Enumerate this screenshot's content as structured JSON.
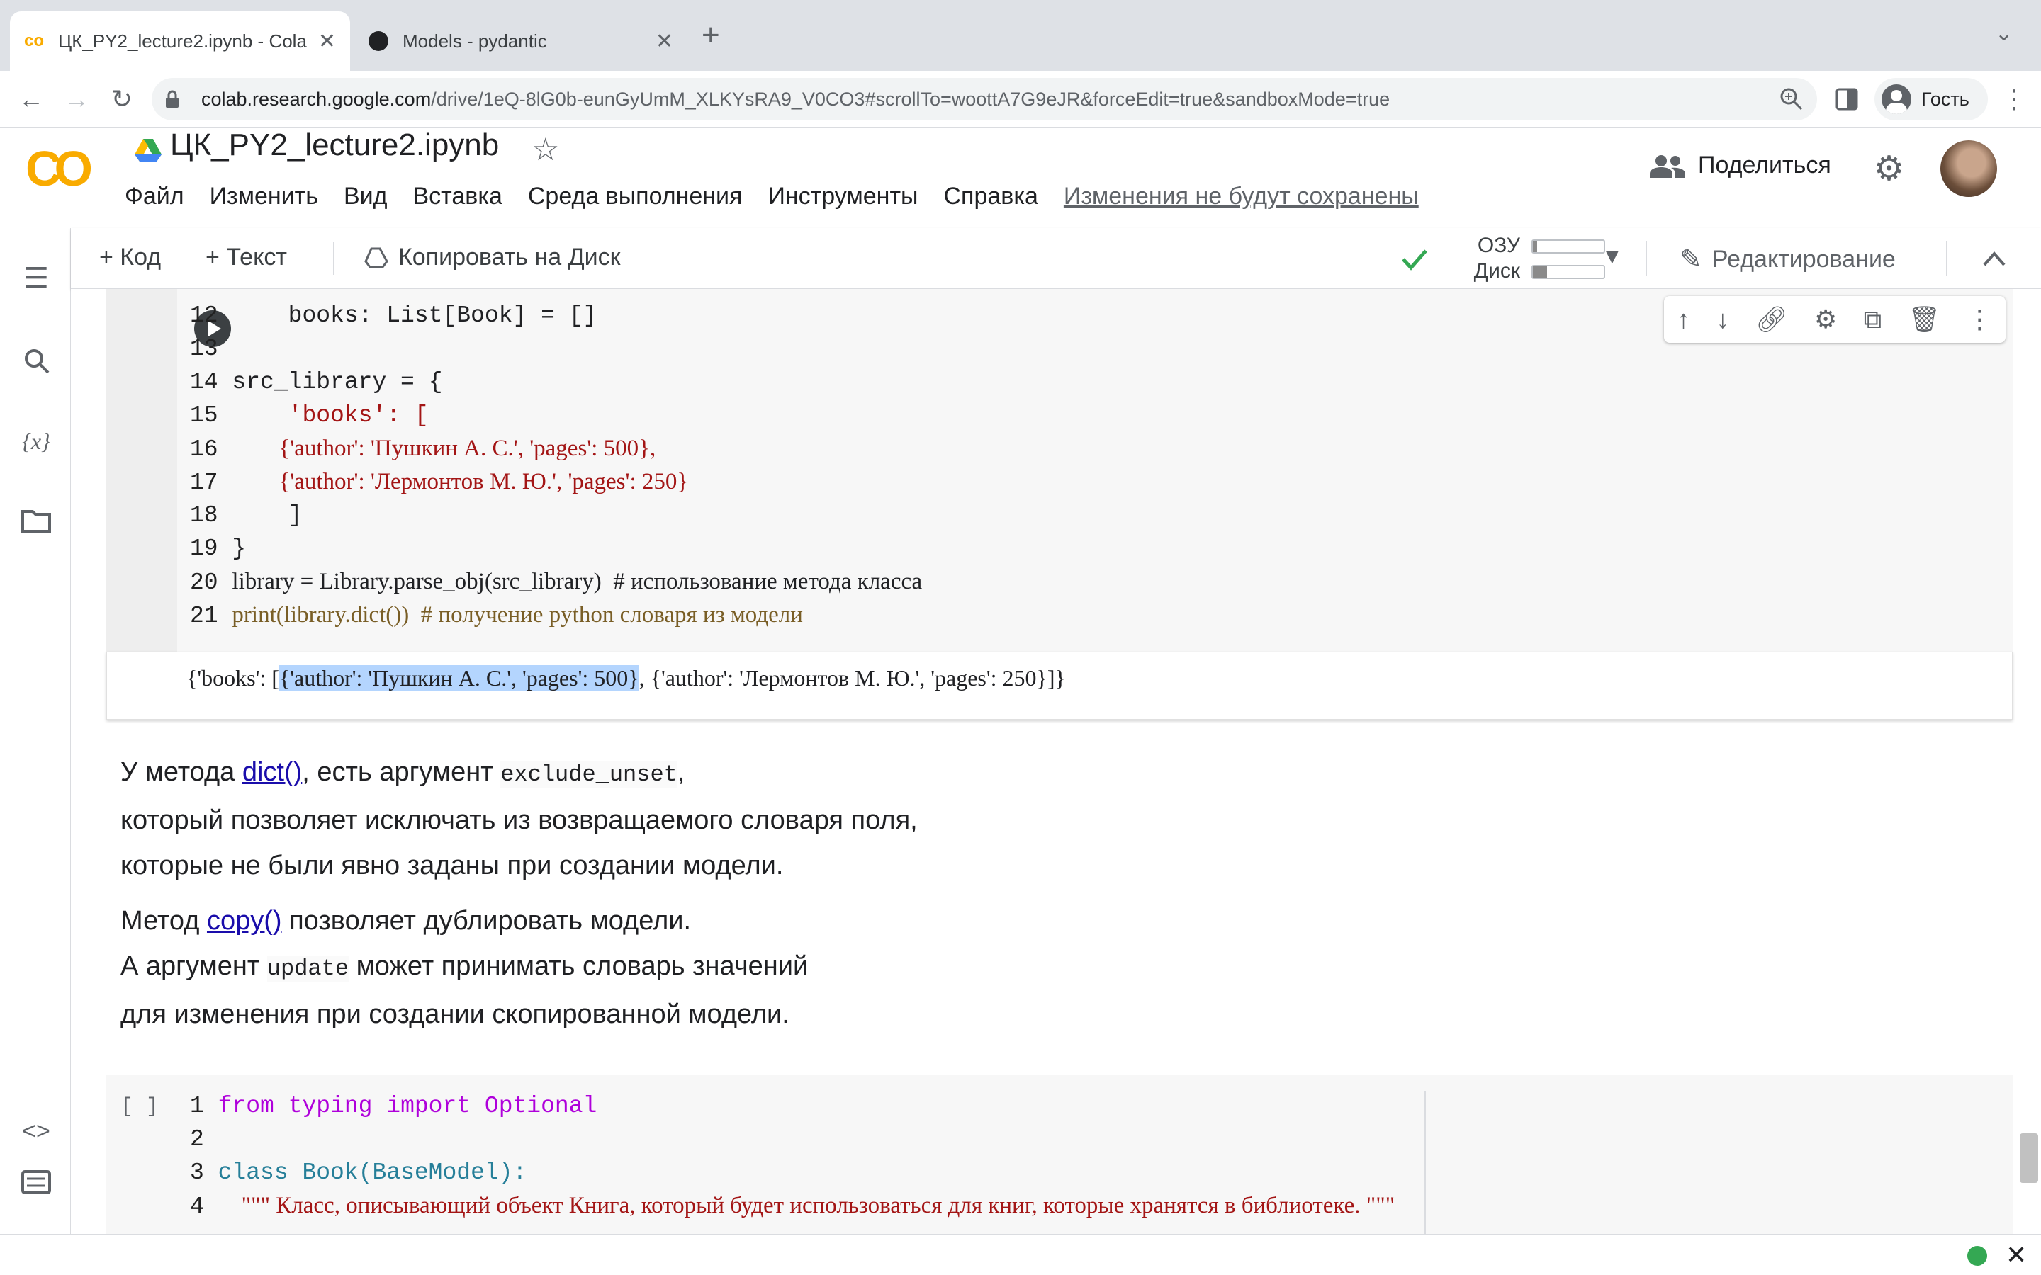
{
  "browser": {
    "tabs": [
      {
        "title": "ЦК_PY2_lecture2.ipynb - Cola",
        "favicon": "colab-favicon-icon",
        "active": true
      },
      {
        "title": "Models - pydantic",
        "favicon": "pydantic-favicon-icon",
        "active": false
      }
    ],
    "url_host": "colab.research.google.com",
    "url_path": "/drive/1eQ-8lG0b-eunGyUmM_XLKYsRA9_V0CO3#scrollTo=woottA7G9eJR&forceEdit=true&sandboxMode=true",
    "profile_label": "Гость"
  },
  "colab": {
    "logo": "CO",
    "notebook_title": "ЦК_PY2_lecture2.ipynb",
    "menu": [
      "Файл",
      "Изменить",
      "Вид",
      "Вставка",
      "Среда выполнения",
      "Инструменты",
      "Справка"
    ],
    "unsaved_notice": "Изменения не будут сохранены",
    "share_label": "Поделиться",
    "toolbar": {
      "add_code": "+ Код",
      "add_text": "+ Текст",
      "copy_to_drive": "Копировать на Диск",
      "ram_label": "ОЗУ",
      "disk_label": "Диск",
      "ram_usage": 0.06,
      "disk_usage": 0.2,
      "editing_label": "Редактирование"
    }
  },
  "cell1": {
    "lines": [
      {
        "n": "12",
        "text": "    books: List[Book] = []"
      },
      {
        "n": "13",
        "text": ""
      },
      {
        "n": "14",
        "text": "src_library = {"
      },
      {
        "n": "15",
        "text": "    'books': ["
      },
      {
        "n": "16",
        "text": "        {'author': 'Пушкин А. С.', 'pages': 500},"
      },
      {
        "n": "17",
        "text": "        {'author': 'Лермонтов М. Ю.', 'pages': 250}"
      },
      {
        "n": "18",
        "text": "    ]"
      },
      {
        "n": "19",
        "text": "}"
      },
      {
        "n": "20",
        "text": "library = Library.parse_obj(src_library)  # использование метода класса"
      },
      {
        "n": "21",
        "text": "print(library.dict())  # получение python словаря из модели"
      }
    ],
    "output_pre": "{'books': [",
    "output_selected": "{'author': 'Пушкин А. С.', 'pages': 500}",
    "output_post": ", {'author': 'Лермонтов М. Ю.', 'pages': 250}]}"
  },
  "text1": {
    "l1_a": "У метода ",
    "l1_link": "dict()",
    "l1_b": ", есть аргумент ",
    "l1_code": "exclude_unset",
    "l1_c": ",",
    "l2": "который позволяет исключать из возвращаемого словаря поля,",
    "l3": "которые не были явно заданы при создании модели."
  },
  "text2": {
    "l1_a": "Метод ",
    "l1_link": "copy()",
    "l1_b": " позволяет дублировать модели.",
    "l2_a": "А аргумент ",
    "l2_code": "update",
    "l2_b": " может принимать словарь значений",
    "l3": "для изменения при создании скопированной модели."
  },
  "cell2": {
    "exec_label": "[ ]",
    "lines": [
      {
        "n": "1",
        "text": "from typing import Optional"
      },
      {
        "n": "2",
        "text": ""
      },
      {
        "n": "3",
        "text": "class Book(BaseModel):"
      },
      {
        "n": "4",
        "text": "    \"\"\" Класс, описывающий объект Книга, который будет использоваться для книг, которые хранятся в библиотеке. \"\"\""
      }
    ]
  },
  "colors": {
    "accent": "#f9ab00",
    "connected": "#34a853",
    "link": "#1a0dab"
  }
}
